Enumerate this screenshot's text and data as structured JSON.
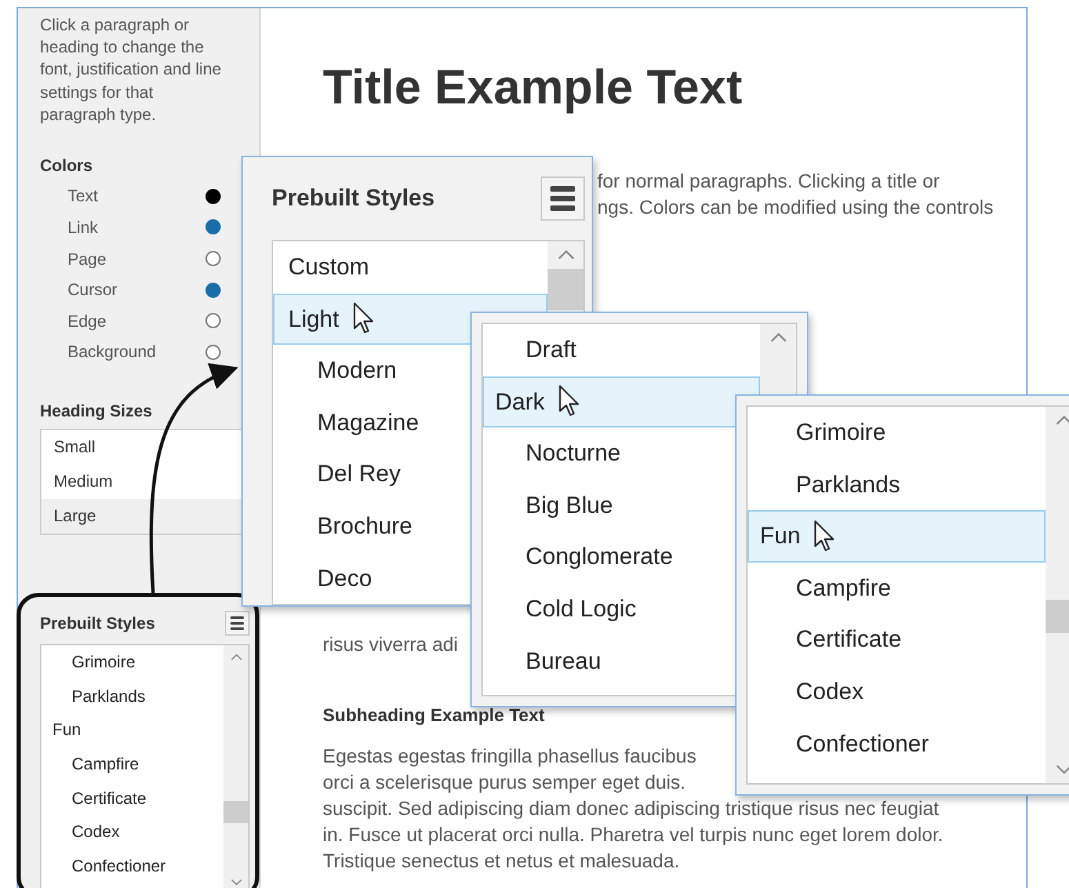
{
  "sidebar": {
    "help_text": "Click a paragraph or heading to change the font, justification and line settings for that paragraph type.",
    "colors_heading": "Colors",
    "colors": [
      {
        "label": "Text",
        "color": "#000000"
      },
      {
        "label": "Link",
        "color": "#1a6ea8"
      },
      {
        "label": "Page",
        "color": "#ffffff"
      },
      {
        "label": "Cursor",
        "color": "#1a6ea8"
      },
      {
        "label": "Edge",
        "color": "#ffffff"
      },
      {
        "label": "Background",
        "color": "#ffffff"
      }
    ],
    "heading_sizes_heading": "Heading Sizes",
    "heading_sizes": [
      {
        "label": "Small",
        "selected": false
      },
      {
        "label": "Medium",
        "selected": false
      },
      {
        "label": "Large",
        "selected": true
      }
    ]
  },
  "document": {
    "blocks": [
      {
        "kind": "title",
        "lines": [
          {
            "text": "Title Example Text"
          }
        ]
      },
      {
        "kind": "cut_paragraph",
        "lines": [
          {
            "text": "for normal paragraphs. Clicking a title or"
          },
          {
            "text": "ngs. Colors can be modified using the controls"
          }
        ]
      },
      {
        "kind": "paragraph",
        "lines": [
          {
            "text": "risus viverra adi"
          }
        ]
      },
      {
        "kind": "subheading",
        "lines": [
          {
            "text": "Subheading Example Text"
          }
        ]
      },
      {
        "kind": "paragraph",
        "lines": [
          {
            "text": "Egestas egestas fringilla phasellus faucibus"
          },
          {
            "text": "orci a scelerisque purus semper eget duis."
          },
          {
            "text": "suscipit. Sed adipiscing diam donec adipiscing tristique risus nec feugiat"
          },
          {
            "text": "in. Fusce ut placerat orci nulla. Pharetra vel turpis nunc eget lorem dolor."
          },
          {
            "text": "Tristique senectus et netus et malesuada."
          }
        ]
      }
    ]
  },
  "popups": [
    {
      "title": "Prebuilt Styles",
      "items": [
        {
          "label": "Custom",
          "kind": "group",
          "selected": false
        },
        {
          "label": "Light",
          "kind": "group",
          "selected": true
        },
        {
          "label": "Modern",
          "kind": "style",
          "selected": false
        },
        {
          "label": "Magazine",
          "kind": "style",
          "selected": false
        },
        {
          "label": "Del Rey",
          "kind": "style",
          "selected": false
        },
        {
          "label": "Brochure",
          "kind": "style",
          "selected": false
        },
        {
          "label": "Deco",
          "kind": "style",
          "selected": false
        }
      ]
    },
    {
      "items": [
        {
          "label": "Draft",
          "kind": "style",
          "selected": false
        },
        {
          "label": "Dark",
          "kind": "group",
          "selected": true
        },
        {
          "label": "Nocturne",
          "kind": "style",
          "selected": false
        },
        {
          "label": "Big Blue",
          "kind": "style",
          "selected": false
        },
        {
          "label": "Conglomerate",
          "kind": "style",
          "selected": false
        },
        {
          "label": "Cold Logic",
          "kind": "style",
          "selected": false
        },
        {
          "label": "Bureau",
          "kind": "style",
          "selected": false
        }
      ]
    },
    {
      "items": [
        {
          "label": "Grimoire",
          "kind": "style",
          "selected": false
        },
        {
          "label": "Parklands",
          "kind": "style",
          "selected": false
        },
        {
          "label": "Fun",
          "kind": "group",
          "selected": true
        },
        {
          "label": "Campfire",
          "kind": "style",
          "selected": false
        },
        {
          "label": "Certificate",
          "kind": "style",
          "selected": false
        },
        {
          "label": "Codex",
          "kind": "style",
          "selected": false
        },
        {
          "label": "Confectioner",
          "kind": "style",
          "selected": false
        }
      ]
    }
  ],
  "callout": {
    "title": "Prebuilt Styles",
    "items": [
      {
        "label": "Grimoire",
        "kind": "style",
        "selected": false
      },
      {
        "label": "Parklands",
        "kind": "style",
        "selected": false
      },
      {
        "label": "Fun",
        "kind": "group",
        "selected": false
      },
      {
        "label": "Campfire",
        "kind": "style",
        "selected": false
      },
      {
        "label": "Certificate",
        "kind": "style",
        "selected": false
      },
      {
        "label": "Codex",
        "kind": "style",
        "selected": false
      },
      {
        "label": "Confectioner",
        "kind": "style",
        "selected": false
      }
    ]
  }
}
